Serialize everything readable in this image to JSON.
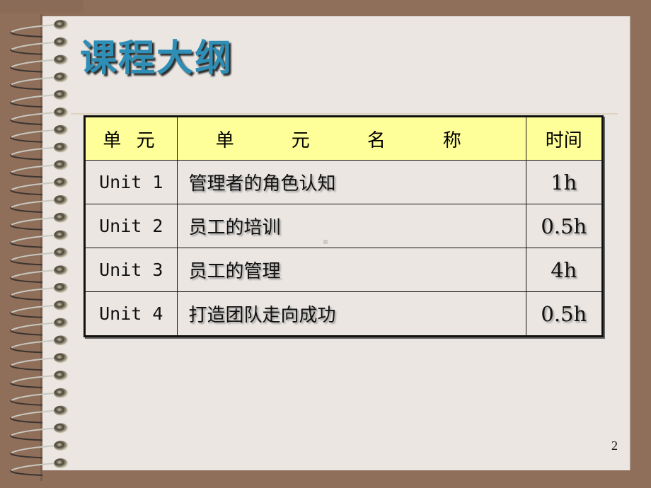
{
  "slide": {
    "title": "课程大纲",
    "page_number": "2",
    "colors": {
      "background": "#8f6e5a",
      "page": "#ebe6e2",
      "title": "#2e8eb5",
      "header_fill": "#ffff99"
    }
  },
  "table": {
    "headers": {
      "unit": "单 元",
      "name": "单 元 名 称",
      "time": "时间"
    },
    "rows": [
      {
        "unit": "Unit 1",
        "name": "管理者的角色认知",
        "time": "1h"
      },
      {
        "unit": "Unit 2",
        "name": "员工的培训",
        "time": "0.5h"
      },
      {
        "unit": "Unit 3",
        "name": "员工的管理",
        "time": "4h"
      },
      {
        "unit": "Unit 4",
        "name": "打造团队走向成功",
        "time": "0.5h"
      }
    ]
  }
}
